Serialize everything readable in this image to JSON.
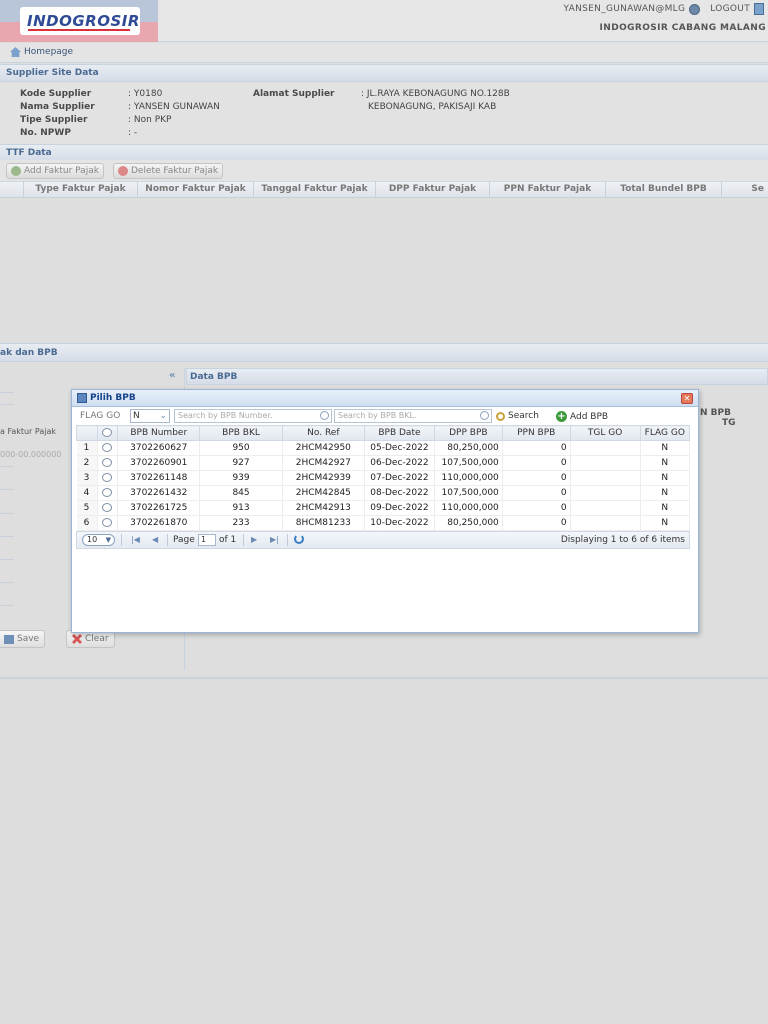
{
  "header": {
    "logo_text": "INDOGROSIR",
    "user": "YANSEN_GUNAWAN@MLG",
    "logout_label": "LOGOUT",
    "branch": "INDOGROSIR CABANG MALANG"
  },
  "nav": {
    "home_label": "Homepage"
  },
  "supplier": {
    "title": "Supplier Site Data",
    "kode_label": "Kode Supplier",
    "kode_value": ": Y0180",
    "nama_label": "Nama Supplier",
    "nama_value": ": YANSEN GUNAWAN",
    "tipe_label": "Tipe Supplier",
    "tipe_value": ": Non PKP",
    "npwp_label": "No. NPWP",
    "npwp_value": ": -",
    "alamat_label": "Alamat Supplier",
    "alamat_line1": ": JL.RAYA KEBONAGUNG NO.128B",
    "alamat_line2": "KEBONAGUNG, PAKISAJI KAB"
  },
  "ttf": {
    "title": "TTF Data",
    "add_label": "Add Faktur Pajak",
    "delete_label": "Delete Faktur Pajak",
    "columns": [
      "Type Faktur Pajak",
      "Nomor Faktur Pajak",
      "Tanggal Faktur Pajak",
      "DPP Faktur Pajak",
      "PPN Faktur Pajak",
      "Total Bundel BPB",
      "Se"
    ]
  },
  "faktur_section": {
    "title": "ak dan BPB"
  },
  "left_pane": {
    "faktur_label": "a Faktur Pajak",
    "faktur_placeholder": "000-00.000000",
    "save_label": "Save",
    "clear_label": "Clear"
  },
  "data_bpb": {
    "title": "Data BPB",
    "col_partial1": "N BPB",
    "col_partial2": "TG"
  },
  "modal": {
    "title": "Pilih BPB",
    "flag_label": "FLAG GO",
    "flag_value": "N",
    "search_bpb_number_placeholder": "Search by BPB Number.",
    "search_bpb_bkl_placeholder": "Search by BPB BKL.",
    "search_label": "Search",
    "add_bpb_label": "Add BPB",
    "columns": [
      "BPB Number",
      "BPB BKL",
      "No. Ref",
      "BPB Date",
      "DPP BPB",
      "PPN BPB",
      "TGL GO",
      "FLAG GO"
    ],
    "rows": [
      {
        "no": "1",
        "bpb_number": "3702260627",
        "bkl": "950",
        "ref": "2HCM42950",
        "date": "05-Dec-2022",
        "dpp": "80,250,000",
        "ppn": "0",
        "tgl_go": "",
        "flag": "N"
      },
      {
        "no": "2",
        "bpb_number": "3702260901",
        "bkl": "927",
        "ref": "2HCM42927",
        "date": "06-Dec-2022",
        "dpp": "107,500,000",
        "ppn": "0",
        "tgl_go": "",
        "flag": "N"
      },
      {
        "no": "3",
        "bpb_number": "3702261148",
        "bkl": "939",
        "ref": "2HCM42939",
        "date": "07-Dec-2022",
        "dpp": "110,000,000",
        "ppn": "0",
        "tgl_go": "",
        "flag": "N"
      },
      {
        "no": "4",
        "bpb_number": "3702261432",
        "bkl": "845",
        "ref": "2HCM42845",
        "date": "08-Dec-2022",
        "dpp": "107,500,000",
        "ppn": "0",
        "tgl_go": "",
        "flag": "N"
      },
      {
        "no": "5",
        "bpb_number": "3702261725",
        "bkl": "913",
        "ref": "2HCM42913",
        "date": "09-Dec-2022",
        "dpp": "110,000,000",
        "ppn": "0",
        "tgl_go": "",
        "flag": "N"
      },
      {
        "no": "6",
        "bpb_number": "3702261870",
        "bkl": "233",
        "ref": "8HCM81233",
        "date": "10-Dec-2022",
        "dpp": "80,250,000",
        "ppn": "0",
        "tgl_go": "",
        "flag": "N"
      }
    ],
    "pager": {
      "page_size": "10",
      "page_label": "Page",
      "page_value": "1",
      "of_label": "of 1",
      "display_text": "Displaying 1 to 6 of 6 items"
    }
  }
}
